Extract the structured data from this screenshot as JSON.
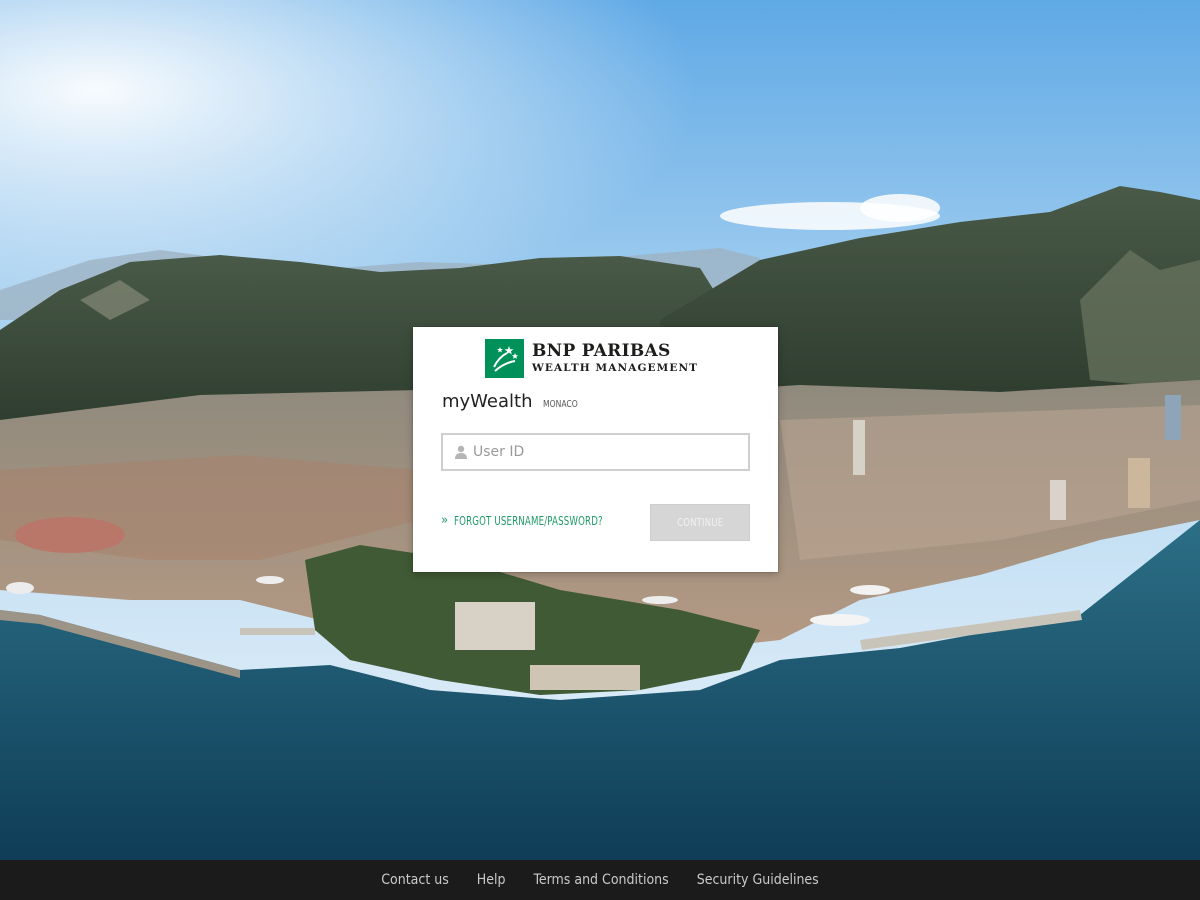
{
  "brand": {
    "name": "BNP PARIBAS",
    "subtitle": "WEALTH MANAGEMENT",
    "logo_color": "#00915a"
  },
  "app": {
    "name": "myWealth",
    "region": "MONACO"
  },
  "login": {
    "userid_placeholder": "User ID",
    "userid_value": "",
    "user_icon": "user-icon",
    "forgot_label": "FORGOT USERNAME/PASSWORD?",
    "forgot_icon": "double-chevron-right-icon",
    "continue_label": "CONTINUE",
    "accent_color": "#1f9b6a"
  },
  "footer": {
    "links": [
      {
        "label": "Contact us"
      },
      {
        "label": "Help"
      },
      {
        "label": "Terms and Conditions"
      },
      {
        "label": "Security Guidelines"
      }
    ]
  }
}
